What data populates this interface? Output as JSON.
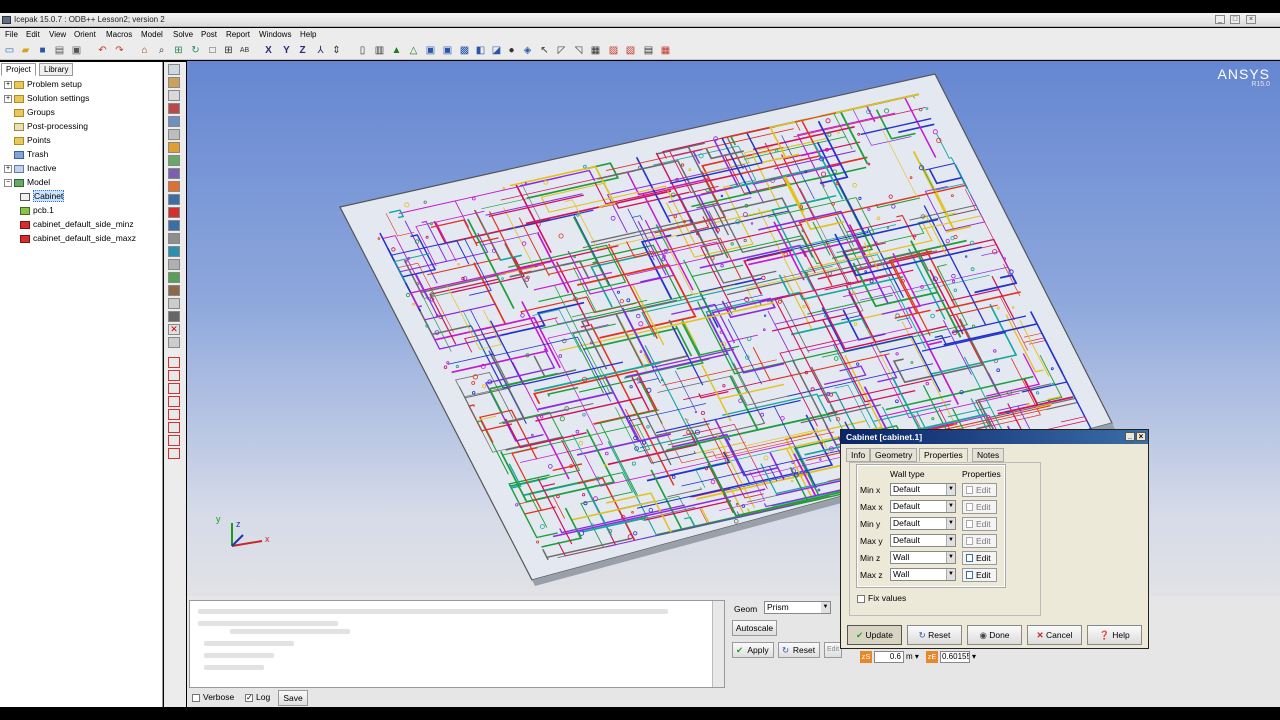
{
  "window": {
    "title": "Icepak 15.0.7 : ODB++ Lesson2; version 2"
  },
  "menu": [
    "File",
    "Edit",
    "View",
    "Orient",
    "Macros",
    "Model",
    "Solve",
    "Post",
    "Report",
    "Windows",
    "Help"
  ],
  "tabs": {
    "project": "Project",
    "library": "Library"
  },
  "tree": [
    {
      "label": "Problem setup",
      "icon": "folder-icon",
      "expandable": true
    },
    {
      "label": "Solution settings",
      "icon": "folder-icon",
      "expandable": true
    },
    {
      "label": "Groups",
      "icon": "folder-icon",
      "expandable": false
    },
    {
      "label": "Post-processing",
      "icon": "post-processing-icon",
      "expandable": false
    },
    {
      "label": "Points",
      "icon": "folder-icon",
      "expandable": false
    },
    {
      "label": "Trash",
      "icon": "trash-icon",
      "expandable": false
    },
    {
      "label": "Inactive",
      "icon": "inactive-icon",
      "expandable": true
    },
    {
      "label": "Model",
      "icon": "model-icon",
      "expandable": true
    },
    {
      "label": "Cabinet",
      "icon": "cabinet-icon",
      "selected": true
    },
    {
      "label": "pcb.1",
      "icon": "pcb-icon"
    },
    {
      "label": "cabinet_default_side_minz",
      "icon": "wall-icon"
    },
    {
      "label": "cabinet_default_side_maxz",
      "icon": "wall-icon"
    }
  ],
  "viewport": {
    "logo": "ANSYS",
    "logo_version": "R15.0",
    "axes": {
      "x": "x",
      "y": "y",
      "z": "z"
    }
  },
  "message": {
    "verbose": "Verbose",
    "log": "Log",
    "save": "Save"
  },
  "edit_panel": {
    "geom_label": "Geom",
    "geom_value": "Prism",
    "autoscale": "Autoscale",
    "apply": "Apply",
    "reset": "Reset",
    "edit": "Edit",
    "zs_label": "zS",
    "zs_value": "0.6",
    "zs_unit": "m",
    "ze_label": "zE",
    "ze_value": "0.60155"
  },
  "dialog": {
    "title": "Cabinet [cabinet.1]",
    "tabs": [
      "Info",
      "Geometry",
      "Properties",
      "Notes"
    ],
    "active_tab": "Properties",
    "col_wall_type": "Wall type",
    "col_properties": "Properties",
    "rows": [
      {
        "label": "Min x",
        "wall": "Default",
        "edit": "Edit",
        "enabled": false
      },
      {
        "label": "Max x",
        "wall": "Default",
        "edit": "Edit",
        "enabled": false
      },
      {
        "label": "Min y",
        "wall": "Default",
        "edit": "Edit",
        "enabled": false
      },
      {
        "label": "Max y",
        "wall": "Default",
        "edit": "Edit",
        "enabled": false
      },
      {
        "label": "Min z",
        "wall": "Wall",
        "edit": "Edit",
        "enabled": true
      },
      {
        "label": "Max z",
        "wall": "Wall",
        "edit": "Edit",
        "enabled": true
      }
    ],
    "fix_values": "Fix values",
    "buttons": {
      "update": "Update",
      "reset": "Reset",
      "done": "Done",
      "cancel": "Cancel",
      "help": "Help"
    }
  }
}
